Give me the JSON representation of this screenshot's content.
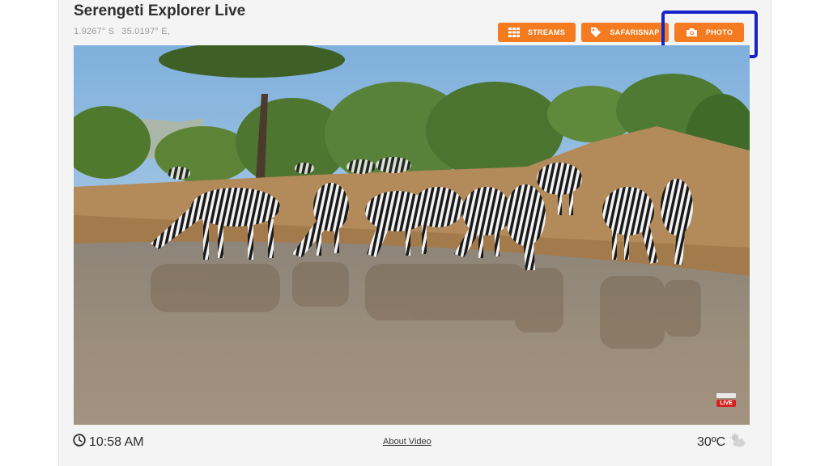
{
  "header": {
    "title": "Serengeti Explorer Live",
    "latitude": "1.9267° S",
    "longitude": "35.0197° E,"
  },
  "buttons": {
    "streams": {
      "label": "STREAMS",
      "icon": "grid-icon"
    },
    "safarisnap": {
      "label": "SAFARISNAP",
      "icon": "tag-icon"
    },
    "photo": {
      "label": "PHOTO",
      "icon": "camera-icon"
    }
  },
  "video": {
    "live_label": "LIVE"
  },
  "footer": {
    "time": "10:58 AM",
    "about_link": "About Video",
    "temperature": "30ºC"
  },
  "colors": {
    "accent": "#f47b20",
    "highlight": "#1521c9",
    "live": "#d42121"
  }
}
